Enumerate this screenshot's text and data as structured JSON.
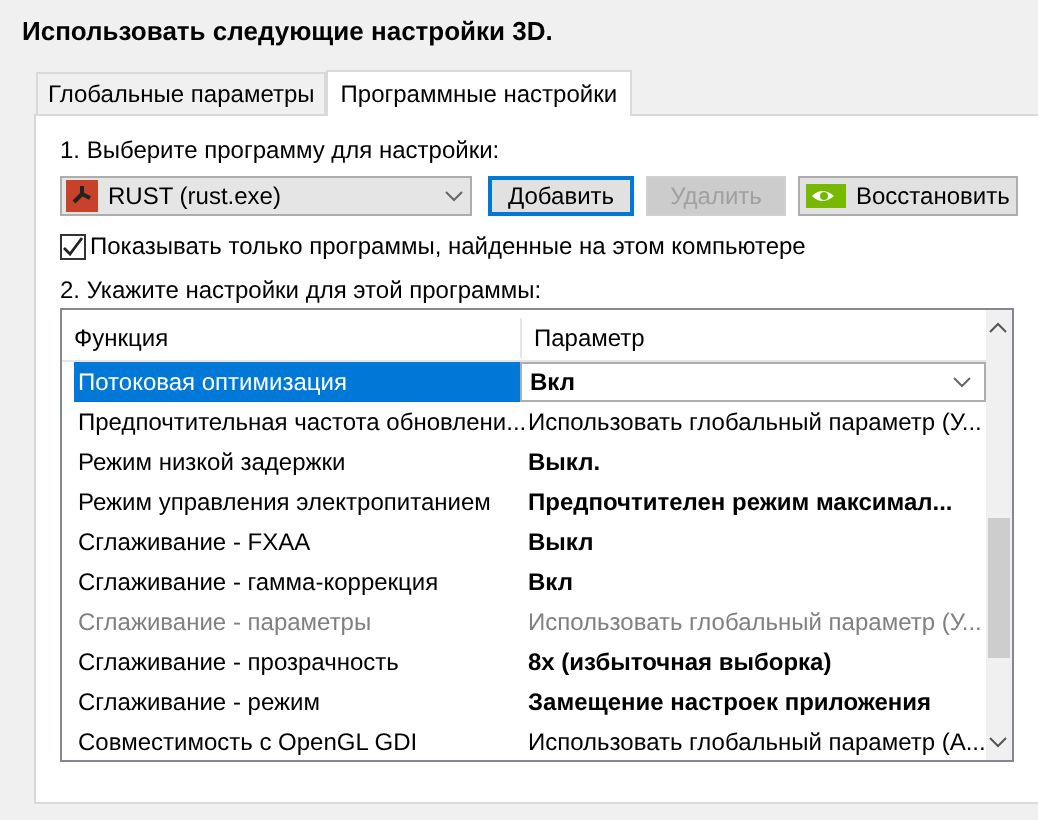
{
  "heading": "Использовать следующие настройки 3D.",
  "tabs": [
    {
      "label": "Глобальные параметры",
      "selected": false
    },
    {
      "label": "Программные настройки",
      "selected": true
    }
  ],
  "step1_label": "1. Выберите программу для настройки:",
  "program_select": {
    "value": "RUST (rust.exe)"
  },
  "buttons": [
    {
      "label": "Добавить",
      "disabled": false,
      "focused": true,
      "kind": "plain"
    },
    {
      "label": "Удалить",
      "disabled": true,
      "focused": false,
      "kind": "plain"
    },
    {
      "label": "Восстановить",
      "disabled": false,
      "focused": false,
      "kind": "logo"
    }
  ],
  "show_only_found": {
    "label": "Показывать только программы, найденные на этом компьютере",
    "checked": true
  },
  "step2_label": "2. Укажите настройки для этой программы:",
  "table": {
    "columns": [
      "Функция",
      "Параметр"
    ],
    "rows": [
      {
        "function": "Потоковая оптимизация",
        "value": "Вкл",
        "bold": true,
        "disabled": false,
        "selected": true
      },
      {
        "function": "Предпочтительная частота обновлени...",
        "value": "Использовать глобальный параметр (У...",
        "bold": false,
        "disabled": false,
        "selected": false
      },
      {
        "function": "Режим низкой задержки",
        "value": "Выкл.",
        "bold": true,
        "disabled": false,
        "selected": false
      },
      {
        "function": "Режим управления электропитанием",
        "value": "Предпочтителен режим максимал...",
        "bold": true,
        "disabled": false,
        "selected": false
      },
      {
        "function": "Сглаживание - FXAA",
        "value": "Выкл",
        "bold": true,
        "disabled": false,
        "selected": false
      },
      {
        "function": "Сглаживание - гамма-коррекция",
        "value": "Вкл",
        "bold": true,
        "disabled": false,
        "selected": false
      },
      {
        "function": "Сглаживание - параметры",
        "value": "Использовать глобальный параметр (У...",
        "bold": false,
        "disabled": true,
        "selected": false
      },
      {
        "function": "Сглаживание - прозрачность",
        "value": "8x (избыточная выборка)",
        "bold": true,
        "disabled": false,
        "selected": false
      },
      {
        "function": "Сглаживание - режим",
        "value": "Замещение настроек приложения",
        "bold": true,
        "disabled": false,
        "selected": false
      },
      {
        "function": "Совместимость с OpenGL GDI",
        "value": "Использовать глобальный параметр (А...",
        "bold": false,
        "disabled": false,
        "selected": false
      }
    ]
  }
}
